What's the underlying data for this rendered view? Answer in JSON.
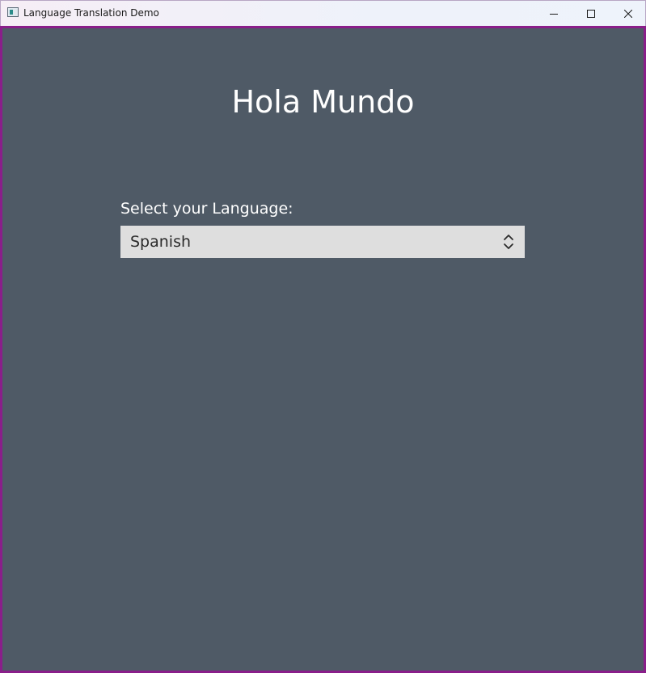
{
  "window": {
    "title": "Language Translation Demo",
    "icon": "app-window-icon",
    "controls": {
      "minimize_icon": "minimize-icon",
      "maximize_icon": "maximize-icon",
      "close_icon": "close-icon"
    },
    "colors": {
      "frame_border": "#8a1e8a",
      "background": "#4f5a66"
    }
  },
  "main": {
    "heading": "Hola Mundo",
    "language_label": "Select your Language:",
    "language_select": {
      "selected": "Spanish",
      "icon": "chevron-up-down-icon"
    }
  }
}
